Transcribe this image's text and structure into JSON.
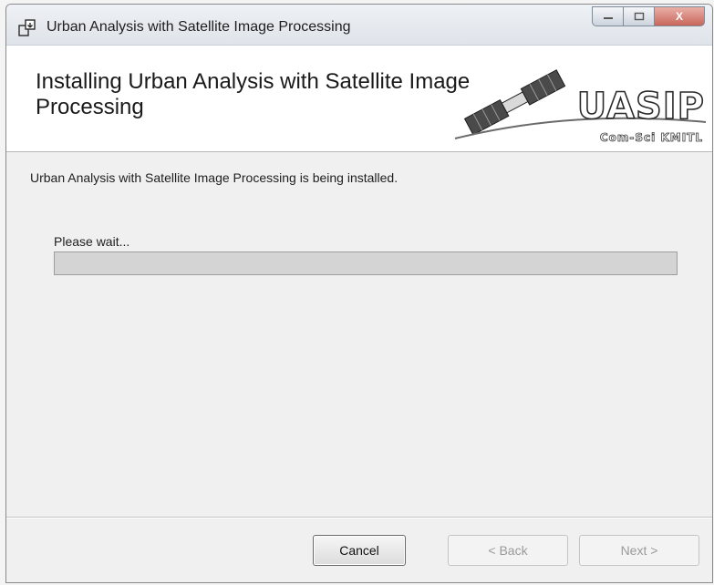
{
  "window": {
    "title": "Urban Analysis with Satellite Image Processing",
    "controls": {
      "minimize_icon": "minimize-icon",
      "maximize_icon": "maximize-icon",
      "close_icon": "close-icon",
      "close_glyph": "X"
    }
  },
  "banner": {
    "title": "Installing Urban Analysis with Satellite Image Processing",
    "logo_text": "UASIP",
    "logo_subtext": "Com-Sci KMITL"
  },
  "status": {
    "message": "Urban Analysis with Satellite Image Processing is being installed.",
    "wait_label": "Please wait...",
    "progress_fraction": 0
  },
  "buttons": {
    "cancel": "Cancel",
    "back": "< Back",
    "next": "Next >"
  },
  "colors": {
    "progress_track": "#d4d4d4",
    "banner_background": "#ffffff",
    "window_background": "#f0f0f0"
  }
}
